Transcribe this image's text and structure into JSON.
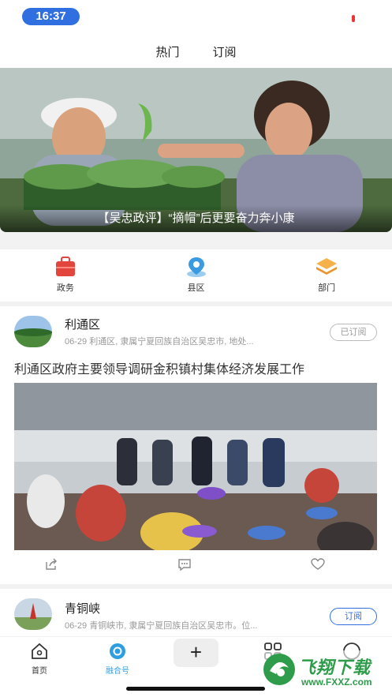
{
  "status_bar": {
    "time": "16:37"
  },
  "top_tabs": [
    {
      "label": "热门"
    },
    {
      "label": "订阅"
    }
  ],
  "banner": {
    "caption": "【吴忠政评】“摘帽”后更要奋力奔小康"
  },
  "quick_nav": [
    {
      "label": "政务",
      "icon": "briefcase-icon",
      "color": "#e2453c"
    },
    {
      "label": "县区",
      "icon": "location-pin-icon",
      "color": "#3a9be3"
    },
    {
      "label": "部门",
      "icon": "layers-icon",
      "color": "#f0a43a"
    }
  ],
  "feed": [
    {
      "source": "利通区",
      "meta": "06-29 利通区, 隶属宁夏回族自治区吴忠市, 地处...",
      "subscribe_label": "已订阅",
      "title": "利通区政府主要领导调研金积镇村集体经济发展工作"
    },
    {
      "source": "青铜峡",
      "meta": "06-29 青铜峡市, 隶属宁夏回族自治区吴忠市。位...",
      "subscribe_label": "订阅"
    }
  ],
  "bottom_nav": [
    {
      "label": "首页",
      "icon": "home-icon"
    },
    {
      "label": "融合号",
      "icon": "media-icon",
      "active": true
    },
    {
      "label": "+",
      "icon": "add-icon"
    },
    {
      "label": "",
      "icon": "grid-icon"
    },
    {
      "label": "",
      "icon": "profile-icon"
    }
  ],
  "watermark": {
    "text": "飞翔下载",
    "url": "www.FXXZ.com"
  },
  "colors": {
    "accent": "#2f6fe0",
    "active_nav": "#2f9ee0"
  }
}
